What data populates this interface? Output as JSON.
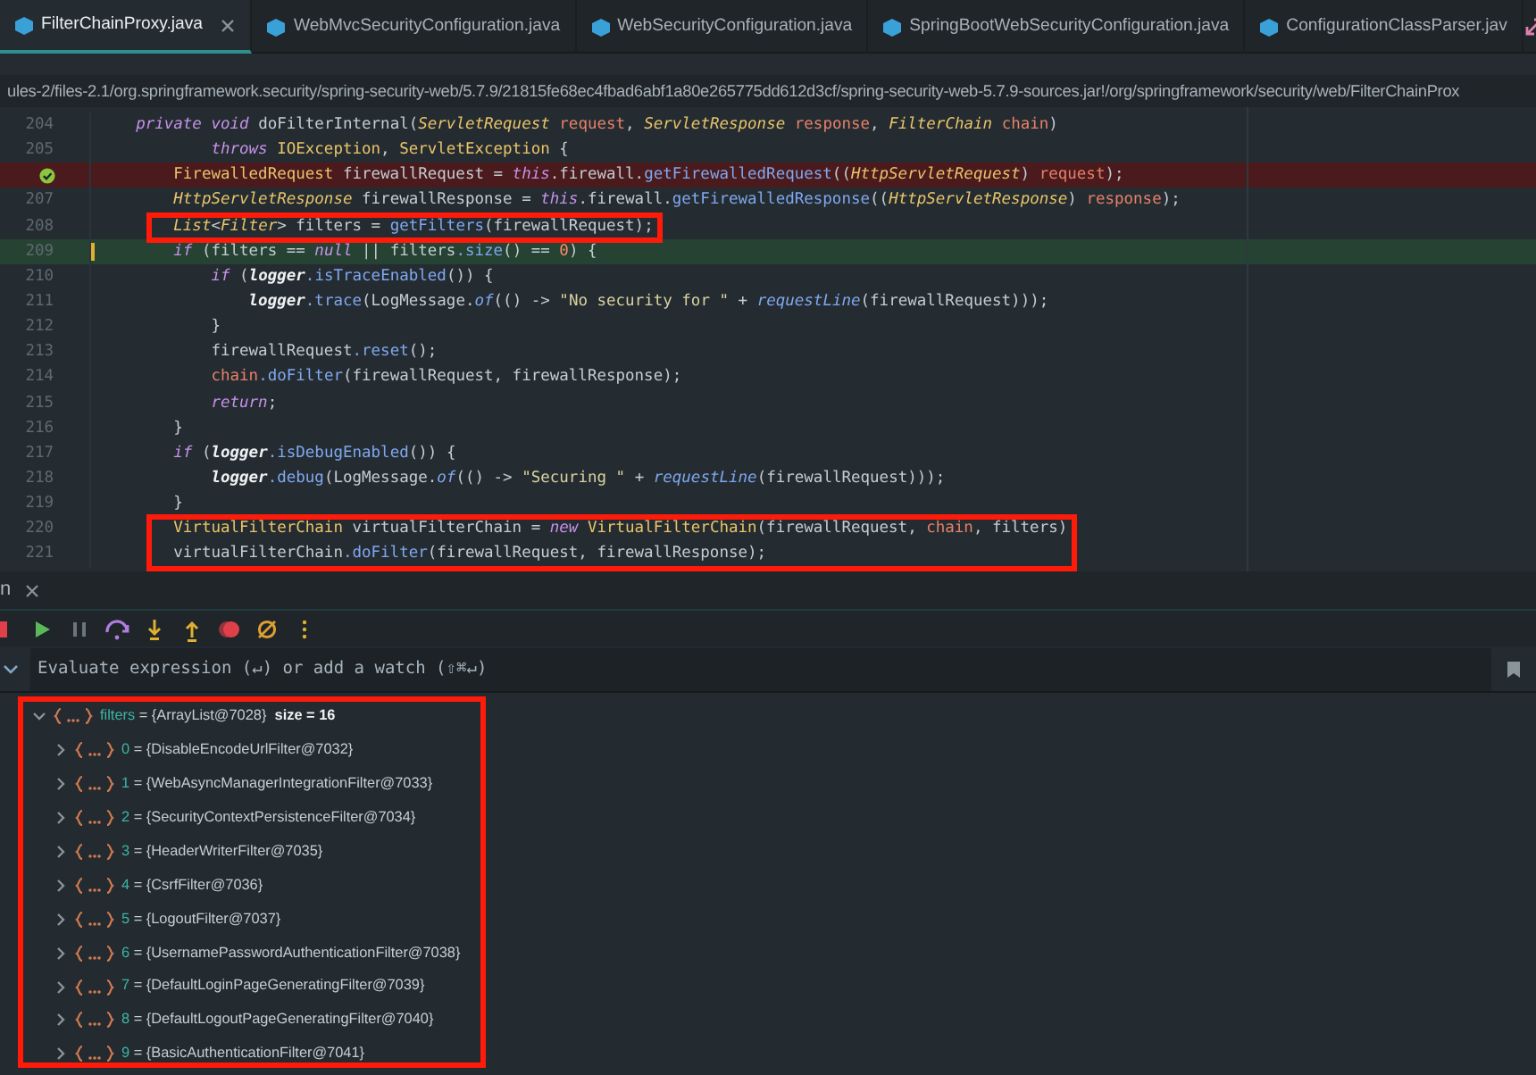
{
  "tabs": [
    {
      "label": "FilterChainProxy.java",
      "selected": true,
      "closable": true
    },
    {
      "label": "WebMvcSecurityConfiguration.java",
      "selected": false,
      "closable": false
    },
    {
      "label": "WebSecurityConfiguration.java",
      "selected": false,
      "closable": false
    },
    {
      "label": "SpringBootWebSecurityConfiguration.java",
      "selected": false,
      "closable": false
    },
    {
      "label": "ConfigurationClassParser.jav",
      "selected": false,
      "closable": false
    }
  ],
  "breadcrumb": "ules-2/files-2.1/org.springframework.security/spring-security-web/5.7.9/21815fe68ec4fbad6abf1a80e265775dd612d3cf/spring-security-web-5.7.9-sources.jar!/org/springframework/security/web/FilterChainProx",
  "code_lines": [
    {
      "number": "204",
      "kind": "normal",
      "boxed": false,
      "tokens": [
        {
          "text": "    private",
          "kind": "kw"
        },
        {
          "text": " void",
          "kind": "kw"
        },
        {
          "text": " doFilterInternal(",
          "kind": "p"
        },
        {
          "text": "ServletRequest",
          "kind": "typeit"
        },
        {
          "text": " request",
          "kind": "param"
        },
        {
          "text": ", ",
          "kind": "p"
        },
        {
          "text": "ServletResponse",
          "kind": "typeit"
        },
        {
          "text": " response",
          "kind": "param"
        },
        {
          "text": ", ",
          "kind": "p"
        },
        {
          "text": "FilterChain",
          "kind": "typeit"
        },
        {
          "text": " chain",
          "kind": "param"
        },
        {
          "text": ")",
          "kind": "p"
        }
      ]
    },
    {
      "number": "205",
      "kind": "normal",
      "boxed": false,
      "tokens": [
        {
          "text": "            throws",
          "kind": "kw"
        },
        {
          "text": " IOException",
          "kind": "type"
        },
        {
          "text": ", ",
          "kind": "p"
        },
        {
          "text": "ServletException",
          "kind": "type"
        },
        {
          "text": " {",
          "kind": "p"
        }
      ]
    },
    {
      "kind": "breakpoint",
      "boxed": false,
      "tokens": [
        {
          "text": "        FirewalledRequest",
          "kind": "type"
        },
        {
          "text": " firewallRequest = ",
          "kind": "p"
        },
        {
          "text": "this",
          "kind": "kw"
        },
        {
          "text": ".firewall.",
          "kind": "p"
        },
        {
          "text": "getFirewalledRequest",
          "kind": "method"
        },
        {
          "text": "((",
          "kind": "p"
        },
        {
          "text": "HttpServletRequest",
          "kind": "typeit"
        },
        {
          "text": ") ",
          "kind": "p"
        },
        {
          "text": "request",
          "kind": "param"
        },
        {
          "text": ");",
          "kind": "p"
        }
      ]
    },
    {
      "number": "207",
      "kind": "normal",
      "boxed": false,
      "tokens": [
        {
          "text": "        HttpServletResponse",
          "kind": "typeit"
        },
        {
          "text": " firewallResponse = ",
          "kind": "p"
        },
        {
          "text": "this",
          "kind": "kw"
        },
        {
          "text": ".firewall.",
          "kind": "p"
        },
        {
          "text": "getFirewalledResponse",
          "kind": "method"
        },
        {
          "text": "((",
          "kind": "p"
        },
        {
          "text": "HttpServletResponse",
          "kind": "typeit"
        },
        {
          "text": ") ",
          "kind": "p"
        },
        {
          "text": "response",
          "kind": "param"
        },
        {
          "text": ");",
          "kind": "p"
        }
      ]
    },
    {
      "number": "208",
      "kind": "normal",
      "boxed": true,
      "tokens": [
        {
          "text": "        List",
          "kind": "typeit"
        },
        {
          "text": "<",
          "kind": "p"
        },
        {
          "text": "Filter",
          "kind": "typeit"
        },
        {
          "text": "> filters = ",
          "kind": "p"
        },
        {
          "text": "getFilters",
          "kind": "method"
        },
        {
          "text": "(firewallRequest);",
          "kind": "p"
        }
      ]
    },
    {
      "number": "209",
      "kind": "current",
      "boxed": false,
      "tokens": [
        {
          "text": "        if",
          "kind": "kw"
        },
        {
          "text": " (filters == ",
          "kind": "p"
        },
        {
          "text": "null",
          "kind": "kw"
        },
        {
          "text": " || filters",
          "kind": "p"
        },
        {
          "text": ".size",
          "kind": "method"
        },
        {
          "text": "() == ",
          "kind": "p"
        },
        {
          "text": "0",
          "kind": "num"
        },
        {
          "text": ") {",
          "kind": "p"
        }
      ]
    },
    {
      "number": "210",
      "kind": "normal",
      "boxed": false,
      "tokens": [
        {
          "text": "            if",
          "kind": "kw"
        },
        {
          "text": " (",
          "kind": "p"
        },
        {
          "text": "logger",
          "kind": "bold"
        },
        {
          "text": ".isTraceEnabled",
          "kind": "method"
        },
        {
          "text": "()) {",
          "kind": "p"
        }
      ]
    },
    {
      "number": "211",
      "kind": "normal",
      "boxed": false,
      "tokens": [
        {
          "text": "                logger",
          "kind": "bold"
        },
        {
          "text": ".trace",
          "kind": "method"
        },
        {
          "text": "(LogMessage.",
          "kind": "p"
        },
        {
          "text": "of",
          "kind": "static"
        },
        {
          "text": "(() -> ",
          "kind": "p"
        },
        {
          "text": "\"No security for \"",
          "kind": "str"
        },
        {
          "text": " + ",
          "kind": "p"
        },
        {
          "text": "requestLine",
          "kind": "static"
        },
        {
          "text": "(firewallRequest)));",
          "kind": "p"
        }
      ]
    },
    {
      "number": "212",
      "kind": "normal",
      "boxed": false,
      "tokens": [
        {
          "text": "            }",
          "kind": "p"
        }
      ]
    },
    {
      "number": "213",
      "kind": "normal",
      "boxed": false,
      "tokens": [
        {
          "text": "            firewallRequest",
          "kind": "p"
        },
        {
          "text": ".reset",
          "kind": "method"
        },
        {
          "text": "();",
          "kind": "p"
        }
      ]
    },
    {
      "number": "214",
      "kind": "normal",
      "boxed": false,
      "tokens": [
        {
          "text": "            chain",
          "kind": "param"
        },
        {
          "text": ".doFilter",
          "kind": "method"
        },
        {
          "text": "(firewallRequest, firewallResponse);",
          "kind": "p"
        }
      ]
    },
    {
      "number": "215",
      "kind": "normal",
      "boxed": false,
      "tokens": [
        {
          "text": "            return",
          "kind": "kw"
        },
        {
          "text": ";",
          "kind": "p"
        }
      ]
    },
    {
      "number": "216",
      "kind": "normal",
      "boxed": false,
      "tokens": [
        {
          "text": "        }",
          "kind": "p"
        }
      ]
    },
    {
      "number": "217",
      "kind": "normal",
      "boxed": false,
      "tokens": [
        {
          "text": "        if",
          "kind": "kw"
        },
        {
          "text": " (",
          "kind": "p"
        },
        {
          "text": "logger",
          "kind": "bold"
        },
        {
          "text": ".isDebugEnabled",
          "kind": "method"
        },
        {
          "text": "()) {",
          "kind": "p"
        }
      ]
    },
    {
      "number": "218",
      "kind": "normal",
      "boxed": false,
      "tokens": [
        {
          "text": "            logger",
          "kind": "bold"
        },
        {
          "text": ".debug",
          "kind": "method"
        },
        {
          "text": "(LogMessage.",
          "kind": "p"
        },
        {
          "text": "of",
          "kind": "static"
        },
        {
          "text": "(() -> ",
          "kind": "p"
        },
        {
          "text": "\"Securing \"",
          "kind": "str"
        },
        {
          "text": " + ",
          "kind": "p"
        },
        {
          "text": "requestLine",
          "kind": "static"
        },
        {
          "text": "(firewallRequest)));",
          "kind": "p"
        }
      ]
    },
    {
      "number": "219",
      "kind": "normal",
      "boxed": false,
      "tokens": [
        {
          "text": "        }",
          "kind": "p"
        }
      ]
    },
    {
      "number": "220",
      "kind": "normal",
      "boxed": true,
      "tokens": [
        {
          "text": "        VirtualFilterChain",
          "kind": "type"
        },
        {
          "text": " virtualFilterChain = ",
          "kind": "p"
        },
        {
          "text": "new",
          "kind": "kw"
        },
        {
          "text": " VirtualFilterChain",
          "kind": "type"
        },
        {
          "text": "(firewallRequest, ",
          "kind": "p"
        },
        {
          "text": "chain",
          "kind": "param"
        },
        {
          "text": ", filters)",
          "kind": "p"
        }
      ]
    },
    {
      "number": "221",
      "kind": "normal",
      "boxed": true,
      "tokens": [
        {
          "text": "        virtualFilterChain",
          "kind": "p"
        },
        {
          "text": ".doFilter",
          "kind": "method"
        },
        {
          "text": "(firewallRequest, firewallResponse);",
          "kind": "p"
        }
      ]
    }
  ],
  "debug_tab": {
    "label": "n",
    "closable": true
  },
  "watch": {
    "placeholder": "Evaluate expression (↵) or add a watch (⇧⌘↵)"
  },
  "variables": {
    "boxed": true,
    "items": [
      {
        "name": "filters",
        "value": "= {ArrayList@7028}",
        "extra": "size = 16",
        "expanded": true,
        "children": [
          {
            "name": "0",
            "value": "= {DisableEncodeUrlFilter@7032}",
            "expanded": false
          },
          {
            "name": "1",
            "value": "= {WebAsyncManagerIntegrationFilter@7033}",
            "expanded": false
          },
          {
            "name": "2",
            "value": "= {SecurityContextPersistenceFilter@7034}",
            "expanded": false
          },
          {
            "name": "3",
            "value": "= {HeaderWriterFilter@7035}",
            "expanded": false
          },
          {
            "name": "4",
            "value": "= {CsrfFilter@7036}",
            "expanded": false
          },
          {
            "name": "5",
            "value": "= {LogoutFilter@7037}",
            "expanded": false
          },
          {
            "name": "6",
            "value": "= {UsernamePasswordAuthenticationFilter@7038}",
            "expanded": false
          },
          {
            "name": "7",
            "value": "= {DefaultLoginPageGeneratingFilter@7039}",
            "expanded": false
          },
          {
            "name": "8",
            "value": "= {DefaultLogoutPageGeneratingFilter@7040}",
            "expanded": false
          },
          {
            "name": "9",
            "value": "= {BasicAuthenticationFilter@7041}",
            "expanded": false
          }
        ]
      }
    ]
  }
}
